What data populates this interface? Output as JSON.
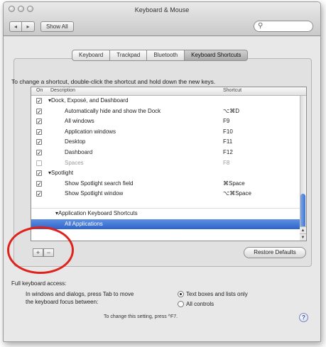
{
  "window": {
    "title": "Keyboard & Mouse"
  },
  "toolbar": {
    "back_label": "◂",
    "forward_label": "▸",
    "show_all_label": "Show All",
    "search_placeholder": ""
  },
  "tabs": [
    {
      "label": "Keyboard",
      "active": false
    },
    {
      "label": "Trackpad",
      "active": false
    },
    {
      "label": "Bluetooth",
      "active": false
    },
    {
      "label": "Keyboard Shortcuts",
      "active": true
    }
  ],
  "instructions": "To change a shortcut, double-click the shortcut and hold down the new keys.",
  "list": {
    "headers": {
      "on": "On",
      "description": "Description",
      "shortcut": "Shortcut"
    },
    "rows": [
      {
        "type": "group",
        "checked": true,
        "label": "▾Dock, Exposé, and Dashboard",
        "shortcut": ""
      },
      {
        "type": "item",
        "checked": true,
        "label": "Automatically hide and show the Dock",
        "shortcut": "⌥⌘D"
      },
      {
        "type": "item",
        "checked": true,
        "label": "All windows",
        "shortcut": "F9"
      },
      {
        "type": "item",
        "checked": true,
        "label": "Application windows",
        "shortcut": "F10"
      },
      {
        "type": "item",
        "checked": true,
        "label": "Desktop",
        "shortcut": "F11"
      },
      {
        "type": "item",
        "checked": true,
        "label": "Dashboard",
        "shortcut": "F12"
      },
      {
        "type": "item",
        "checked": false,
        "label": "Spaces",
        "shortcut": "F8",
        "dim": true
      },
      {
        "type": "group",
        "checked": true,
        "label": "▾Spotlight",
        "shortcut": ""
      },
      {
        "type": "item",
        "checked": true,
        "label": "Show Spotlight search field",
        "shortcut": "⌘Space"
      },
      {
        "type": "item",
        "checked": true,
        "label": "Show Spotlight window",
        "shortcut": "⌥⌘Space"
      }
    ],
    "app_group_label": "▾Application Keyboard Shortcuts",
    "app_item_label": "All Applications"
  },
  "buttons": {
    "add": "+",
    "remove": "−",
    "restore_defaults": "Restore Defaults"
  },
  "full_keyboard_access": {
    "title": "Full keyboard access:",
    "desc_line1": "In windows and dialogs, press Tab to move",
    "desc_line2": "the keyboard focus between:",
    "option1": "Text boxes and lists only",
    "option2": "All controls",
    "selected": "Text boxes and lists only",
    "hint": "To change this setting, press ^F7.",
    "help": "?"
  },
  "annotation": {
    "circle_color": "#e0221d"
  }
}
